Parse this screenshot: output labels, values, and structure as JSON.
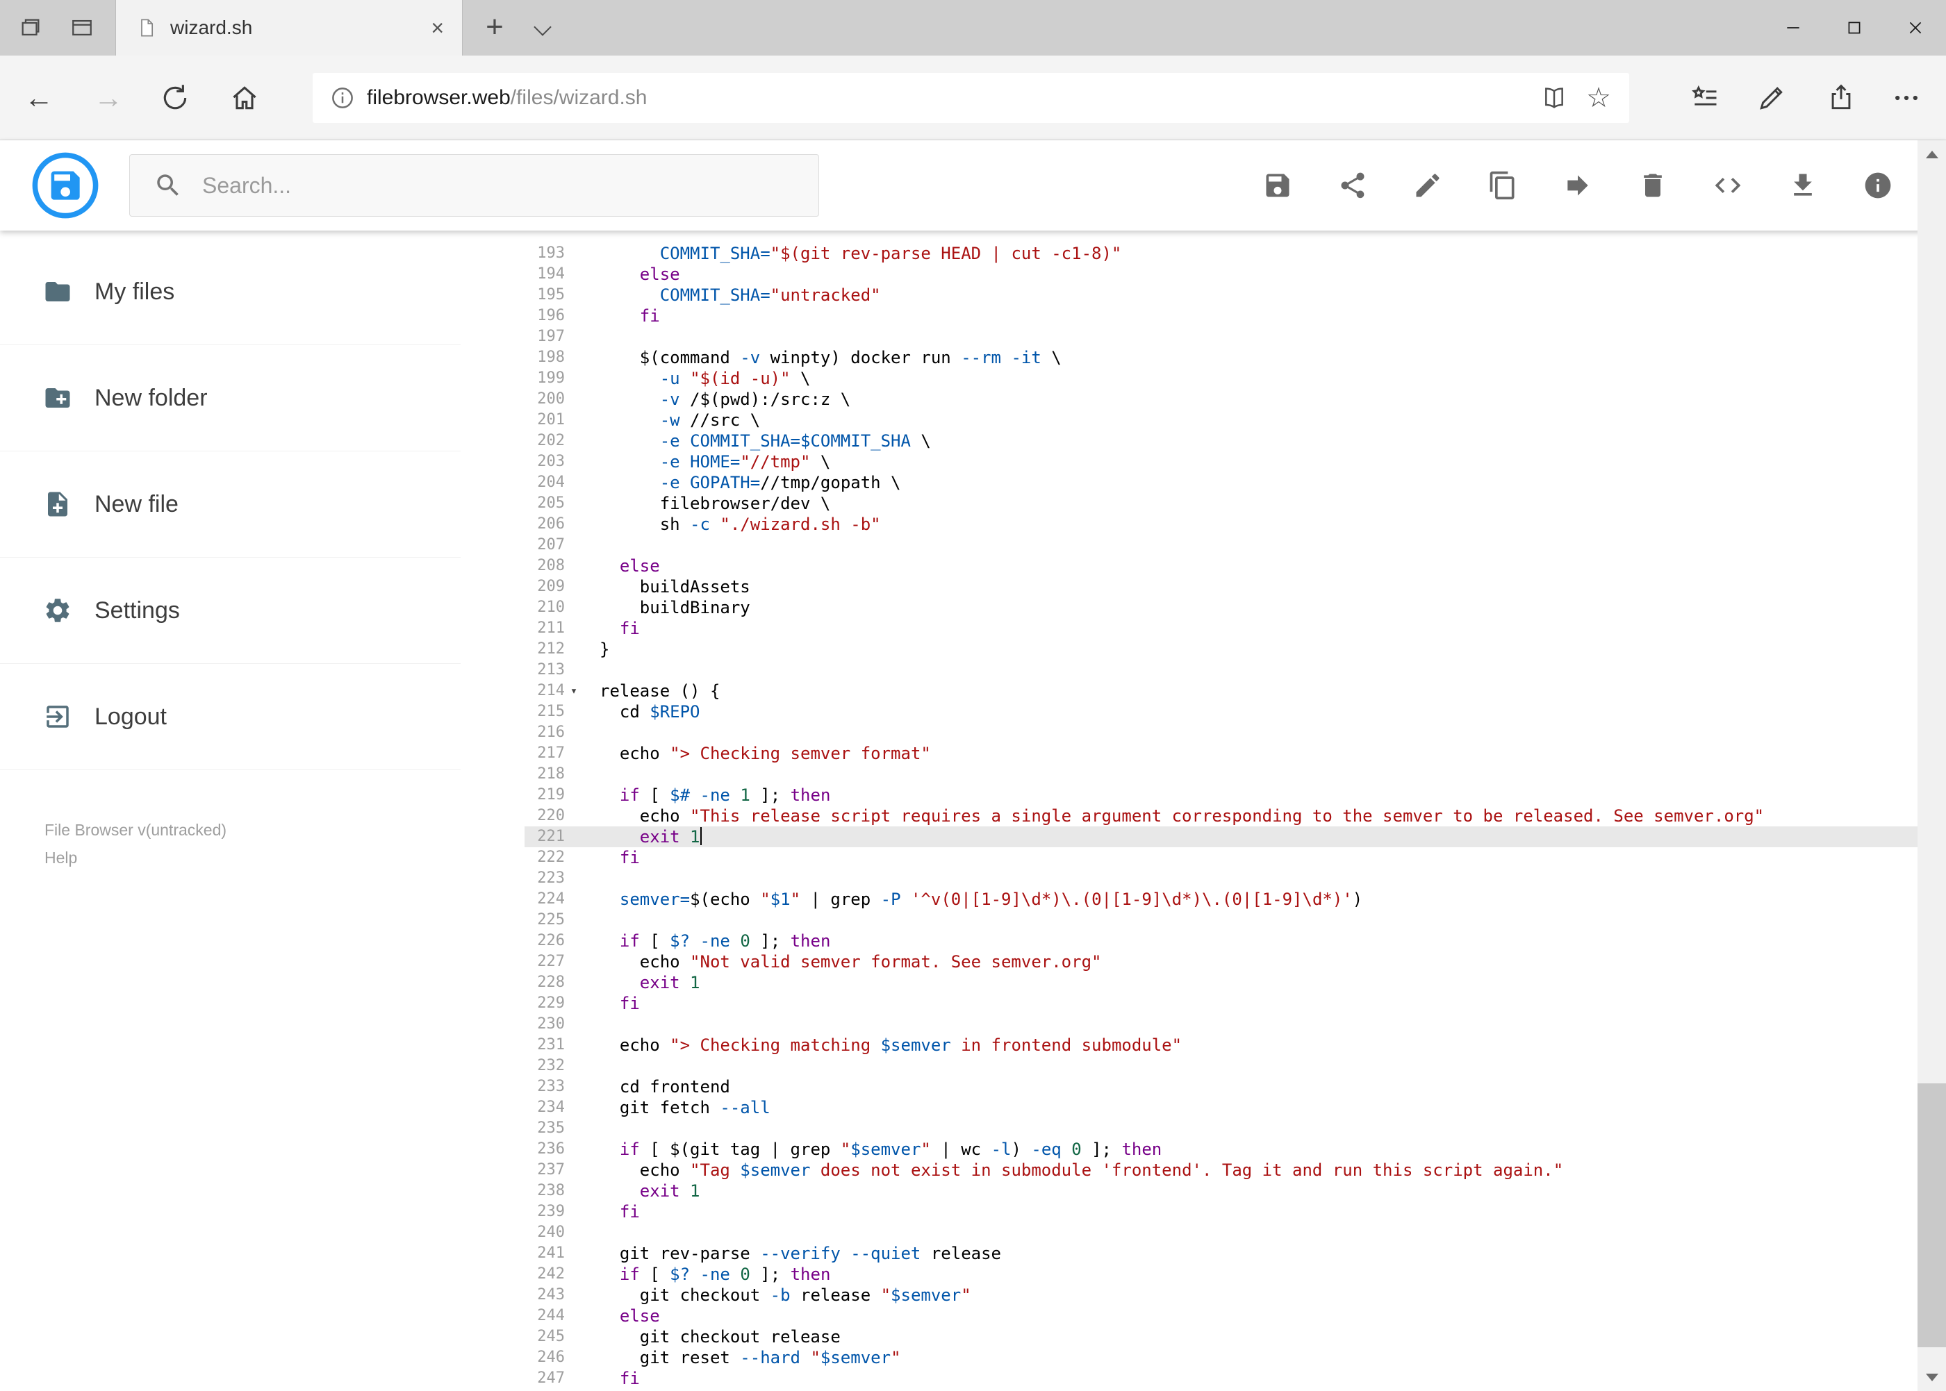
{
  "browser": {
    "tab_title": "wizard.sh",
    "new_tab_label": "+",
    "close_tab_glyph": "×",
    "address": {
      "domain": "filebrowser.web",
      "path": "/files/wizard.sh"
    },
    "nav": {
      "back_glyph": "←",
      "forward_glyph": "→",
      "favorite_glyph": "☆"
    }
  },
  "header": {
    "search_placeholder": "Search...",
    "action_icons": [
      "save",
      "share",
      "edit",
      "copy",
      "move",
      "delete",
      "source-code",
      "download",
      "info"
    ]
  },
  "sidebar": {
    "items": [
      {
        "icon": "folder",
        "label": "My files"
      },
      {
        "icon": "create-new-folder",
        "label": "New folder"
      },
      {
        "icon": "new-file",
        "label": "New file"
      },
      {
        "icon": "settings-gear",
        "label": "Settings"
      },
      {
        "icon": "logout",
        "label": "Logout"
      }
    ],
    "footer_version": "File Browser v(untracked)",
    "footer_help": "Help"
  },
  "editor": {
    "language": "shell",
    "active_line": "221",
    "cursor_line": "221",
    "fold_line": "214",
    "fold_glyph": "▾",
    "colors": {
      "plain": "#000000",
      "keyword": "#770088",
      "variable": "#0055aa",
      "string": "#aa1111",
      "number": "#116644",
      "active_line_bg": "#e8e8e8"
    },
    "lines": [
      {
        "n": "193",
        "t": [
          [
            "p",
            "      "
          ],
          [
            "v",
            "COMMIT_SHA="
          ],
          [
            "s",
            "\"$(git rev-parse HEAD | cut -c1-8)\""
          ]
        ]
      },
      {
        "n": "194",
        "t": [
          [
            "p",
            "    "
          ],
          [
            "k",
            "else"
          ]
        ]
      },
      {
        "n": "195",
        "t": [
          [
            "p",
            "      "
          ],
          [
            "v",
            "COMMIT_SHA="
          ],
          [
            "s",
            "\"untracked\""
          ]
        ]
      },
      {
        "n": "196",
        "t": [
          [
            "p",
            "    "
          ],
          [
            "k",
            "fi"
          ]
        ]
      },
      {
        "n": "197",
        "t": []
      },
      {
        "n": "198",
        "t": [
          [
            "p",
            "    $(command "
          ],
          [
            "v",
            "-v"
          ],
          [
            "p",
            " winpty) docker run "
          ],
          [
            "v",
            "--rm"
          ],
          [
            "p",
            " "
          ],
          [
            "v",
            "-it"
          ],
          [
            "p",
            " \\"
          ]
        ]
      },
      {
        "n": "199",
        "t": [
          [
            "p",
            "      "
          ],
          [
            "v",
            "-u"
          ],
          [
            "p",
            " "
          ],
          [
            "s",
            "\"$(id -u)\""
          ],
          [
            "p",
            " \\"
          ]
        ]
      },
      {
        "n": "200",
        "t": [
          [
            "p",
            "      "
          ],
          [
            "v",
            "-v"
          ],
          [
            "p",
            " /$(pwd):/src:z \\"
          ]
        ]
      },
      {
        "n": "201",
        "t": [
          [
            "p",
            "      "
          ],
          [
            "v",
            "-w"
          ],
          [
            "p",
            " //src \\"
          ]
        ]
      },
      {
        "n": "202",
        "t": [
          [
            "p",
            "      "
          ],
          [
            "v",
            "-e"
          ],
          [
            "p",
            " "
          ],
          [
            "v",
            "COMMIT_SHA=$COMMIT_SHA"
          ],
          [
            "p",
            " \\"
          ]
        ]
      },
      {
        "n": "203",
        "t": [
          [
            "p",
            "      "
          ],
          [
            "v",
            "-e"
          ],
          [
            "p",
            " "
          ],
          [
            "v",
            "HOME="
          ],
          [
            "s",
            "\"//tmp\""
          ],
          [
            "p",
            " \\"
          ]
        ]
      },
      {
        "n": "204",
        "t": [
          [
            "p",
            "      "
          ],
          [
            "v",
            "-e"
          ],
          [
            "p",
            " "
          ],
          [
            "v",
            "GOPATH="
          ],
          [
            "p",
            "//tmp/gopath \\"
          ]
        ]
      },
      {
        "n": "205",
        "t": [
          [
            "p",
            "      filebrowser/dev \\"
          ]
        ]
      },
      {
        "n": "206",
        "t": [
          [
            "p",
            "      sh "
          ],
          [
            "v",
            "-c"
          ],
          [
            "p",
            " "
          ],
          [
            "s",
            "\"./wizard.sh -b\""
          ]
        ]
      },
      {
        "n": "207",
        "t": []
      },
      {
        "n": "208",
        "t": [
          [
            "p",
            "  "
          ],
          [
            "k",
            "else"
          ]
        ]
      },
      {
        "n": "209",
        "t": [
          [
            "p",
            "    buildAssets"
          ]
        ]
      },
      {
        "n": "210",
        "t": [
          [
            "p",
            "    buildBinary"
          ]
        ]
      },
      {
        "n": "211",
        "t": [
          [
            "p",
            "  "
          ],
          [
            "k",
            "fi"
          ]
        ]
      },
      {
        "n": "212",
        "t": [
          [
            "p",
            "}"
          ]
        ]
      },
      {
        "n": "213",
        "t": []
      },
      {
        "n": "214",
        "t": [
          [
            "p",
            "release () {"
          ]
        ]
      },
      {
        "n": "215",
        "t": [
          [
            "p",
            "  cd "
          ],
          [
            "v",
            "$REPO"
          ]
        ]
      },
      {
        "n": "216",
        "t": []
      },
      {
        "n": "217",
        "t": [
          [
            "p",
            "  echo "
          ],
          [
            "s",
            "\"> Checking semver format\""
          ]
        ]
      },
      {
        "n": "218",
        "t": []
      },
      {
        "n": "219",
        "t": [
          [
            "p",
            "  "
          ],
          [
            "k",
            "if"
          ],
          [
            "p",
            " [ "
          ],
          [
            "v",
            "$#"
          ],
          [
            "p",
            " "
          ],
          [
            "v",
            "-ne"
          ],
          [
            "p",
            " "
          ],
          [
            "m",
            "1"
          ],
          [
            "p",
            " ]; "
          ],
          [
            "k",
            "then"
          ]
        ]
      },
      {
        "n": "220",
        "t": [
          [
            "p",
            "    echo "
          ],
          [
            "s",
            "\"This release script requires a single argument corresponding to the semver to be released. See semver.org\""
          ]
        ]
      },
      {
        "n": "221",
        "t": [
          [
            "p",
            "    "
          ],
          [
            "k",
            "exit"
          ],
          [
            "p",
            " "
          ],
          [
            "m",
            "1"
          ]
        ]
      },
      {
        "n": "222",
        "t": [
          [
            "p",
            "  "
          ],
          [
            "k",
            "fi"
          ]
        ]
      },
      {
        "n": "223",
        "t": []
      },
      {
        "n": "224",
        "t": [
          [
            "p",
            "  "
          ],
          [
            "v",
            "semver="
          ],
          [
            "p",
            "$(echo "
          ],
          [
            "s",
            "\""
          ],
          [
            "v",
            "$1"
          ],
          [
            "s",
            "\""
          ],
          [
            "p",
            " | grep "
          ],
          [
            "v",
            "-P"
          ],
          [
            "p",
            " "
          ],
          [
            "s",
            "'^v(0|[1-9]\\d*)\\.(0|[1-9]\\d*)\\.(0|[1-9]\\d*)'"
          ],
          [
            "p",
            ")"
          ]
        ]
      },
      {
        "n": "225",
        "t": []
      },
      {
        "n": "226",
        "t": [
          [
            "p",
            "  "
          ],
          [
            "k",
            "if"
          ],
          [
            "p",
            " [ "
          ],
          [
            "v",
            "$?"
          ],
          [
            "p",
            " "
          ],
          [
            "v",
            "-ne"
          ],
          [
            "p",
            " "
          ],
          [
            "m",
            "0"
          ],
          [
            "p",
            " ]; "
          ],
          [
            "k",
            "then"
          ]
        ]
      },
      {
        "n": "227",
        "t": [
          [
            "p",
            "    echo "
          ],
          [
            "s",
            "\"Not valid semver format. See semver.org\""
          ]
        ]
      },
      {
        "n": "228",
        "t": [
          [
            "p",
            "    "
          ],
          [
            "k",
            "exit"
          ],
          [
            "p",
            " "
          ],
          [
            "m",
            "1"
          ]
        ]
      },
      {
        "n": "229",
        "t": [
          [
            "p",
            "  "
          ],
          [
            "k",
            "fi"
          ]
        ]
      },
      {
        "n": "230",
        "t": []
      },
      {
        "n": "231",
        "t": [
          [
            "p",
            "  echo "
          ],
          [
            "s",
            "\"> Checking matching "
          ],
          [
            "v",
            "$semver"
          ],
          [
            "s",
            " in frontend submodule\""
          ]
        ]
      },
      {
        "n": "232",
        "t": []
      },
      {
        "n": "233",
        "t": [
          [
            "p",
            "  cd frontend"
          ]
        ]
      },
      {
        "n": "234",
        "t": [
          [
            "p",
            "  git fetch "
          ],
          [
            "v",
            "--all"
          ]
        ]
      },
      {
        "n": "235",
        "t": []
      },
      {
        "n": "236",
        "t": [
          [
            "p",
            "  "
          ],
          [
            "k",
            "if"
          ],
          [
            "p",
            " [ $(git tag | grep "
          ],
          [
            "s",
            "\""
          ],
          [
            "v",
            "$semver"
          ],
          [
            "s",
            "\""
          ],
          [
            "p",
            " | wc "
          ],
          [
            "v",
            "-l"
          ],
          [
            "p",
            ") "
          ],
          [
            "v",
            "-eq"
          ],
          [
            "p",
            " "
          ],
          [
            "m",
            "0"
          ],
          [
            "p",
            " ]; "
          ],
          [
            "k",
            "then"
          ]
        ]
      },
      {
        "n": "237",
        "t": [
          [
            "p",
            "    echo "
          ],
          [
            "s",
            "\"Tag "
          ],
          [
            "v",
            "$semver"
          ],
          [
            "s",
            " does not exist in submodule 'frontend'. Tag it and run this script again.\""
          ]
        ]
      },
      {
        "n": "238",
        "t": [
          [
            "p",
            "    "
          ],
          [
            "k",
            "exit"
          ],
          [
            "p",
            " "
          ],
          [
            "m",
            "1"
          ]
        ]
      },
      {
        "n": "239",
        "t": [
          [
            "p",
            "  "
          ],
          [
            "k",
            "fi"
          ]
        ]
      },
      {
        "n": "240",
        "t": []
      },
      {
        "n": "241",
        "t": [
          [
            "p",
            "  git rev-parse "
          ],
          [
            "v",
            "--verify"
          ],
          [
            "p",
            " "
          ],
          [
            "v",
            "--quiet"
          ],
          [
            "p",
            " release"
          ]
        ]
      },
      {
        "n": "242",
        "t": [
          [
            "p",
            "  "
          ],
          [
            "k",
            "if"
          ],
          [
            "p",
            " [ "
          ],
          [
            "v",
            "$?"
          ],
          [
            "p",
            " "
          ],
          [
            "v",
            "-ne"
          ],
          [
            "p",
            " "
          ],
          [
            "m",
            "0"
          ],
          [
            "p",
            " ]; "
          ],
          [
            "k",
            "then"
          ]
        ]
      },
      {
        "n": "243",
        "t": [
          [
            "p",
            "    git checkout "
          ],
          [
            "v",
            "-b"
          ],
          [
            "p",
            " release "
          ],
          [
            "s",
            "\""
          ],
          [
            "v",
            "$semver"
          ],
          [
            "s",
            "\""
          ]
        ]
      },
      {
        "n": "244",
        "t": [
          [
            "p",
            "  "
          ],
          [
            "k",
            "else"
          ]
        ]
      },
      {
        "n": "245",
        "t": [
          [
            "p",
            "    git checkout release"
          ]
        ]
      },
      {
        "n": "246",
        "t": [
          [
            "p",
            "    git reset "
          ],
          [
            "v",
            "--hard"
          ],
          [
            "p",
            " "
          ],
          [
            "s",
            "\""
          ],
          [
            "v",
            "$semver"
          ],
          [
            "s",
            "\""
          ]
        ]
      },
      {
        "n": "247",
        "t": [
          [
            "p",
            "  "
          ],
          [
            "k",
            "fi"
          ]
        ]
      }
    ]
  }
}
